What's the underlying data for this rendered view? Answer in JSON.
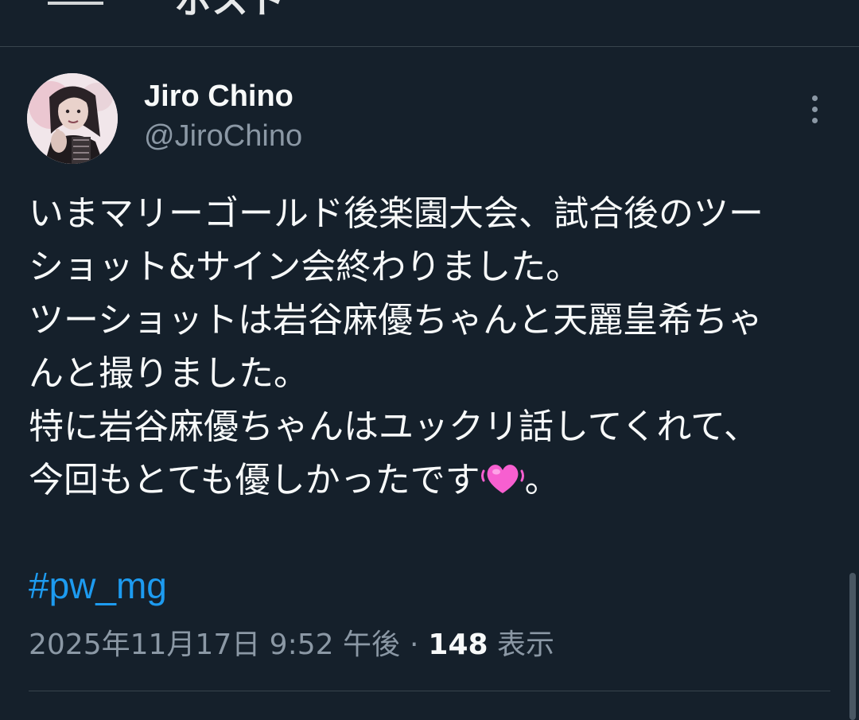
{
  "header": {
    "fragment_text": "ポスト"
  },
  "tweet": {
    "author": {
      "name": "Jiro Chino",
      "handle": "@JiroChino"
    },
    "body_lines": [
      "いまマリーゴールド後楽園大会、試合後のツー",
      "ショット&サイン会終わりました。",
      "ツーショットは岩谷麻優ちゃんと天麗皇希ちゃ",
      "んと撮りました。",
      "特に岩谷麻優ちゃんはユックリ話してくれて、",
      "今回もとても優しかったです"
    ],
    "body_last_suffix": "。",
    "emoji": "heart-emoji",
    "hashtag": "#pw_mg",
    "timestamp": "2025年11月17日 9:52 午後",
    "separator": "·",
    "views_count": "148",
    "views_label": "表示"
  },
  "colors": {
    "background": "#15202b",
    "text_primary": "#f7f9f9",
    "text_secondary": "#8b98a5",
    "link": "#1d9bf0",
    "divider": "#38444d",
    "heart": "#f75fd0"
  },
  "icons": {
    "more": "more-vertical-icon"
  }
}
